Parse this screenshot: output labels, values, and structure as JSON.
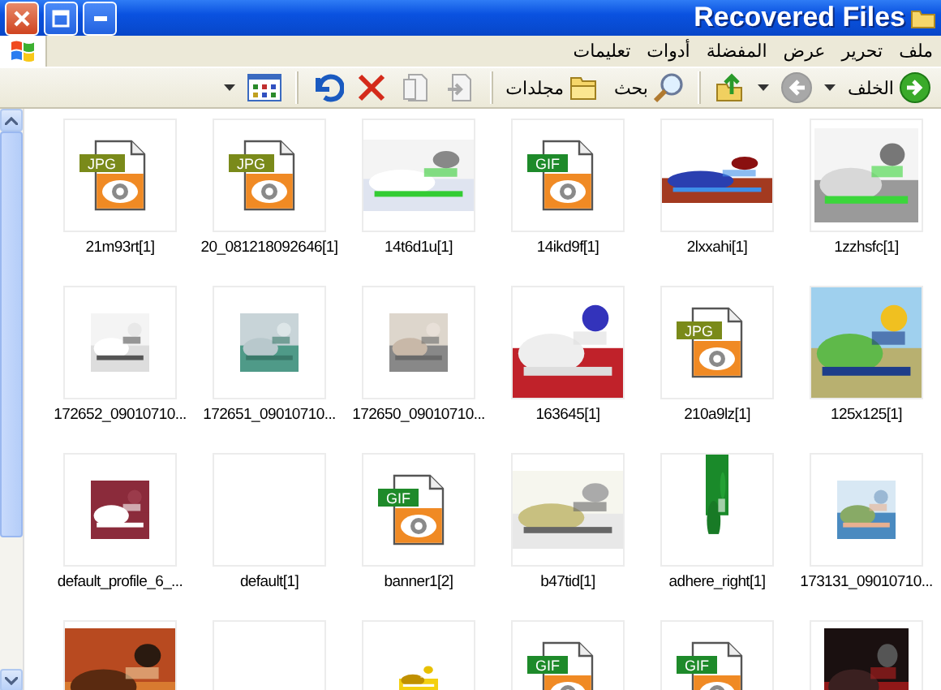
{
  "window": {
    "title": "Recovered Files"
  },
  "menu": [
    "ملف",
    "تحرير",
    "عرض",
    "المفضلة",
    "أدوات",
    "تعليمات"
  ],
  "toolbar": [
    {
      "kind": "back",
      "label": "الخلف",
      "disabled": false
    },
    {
      "kind": "forward",
      "disabled": true
    },
    {
      "kind": "up",
      "disabled": false
    },
    {
      "kind": "separator"
    },
    {
      "kind": "search",
      "label": "بحث",
      "disabled": false
    },
    {
      "kind": "folders",
      "label": "مجلدات",
      "disabled": false
    },
    {
      "kind": "separator"
    },
    {
      "kind": "move",
      "disabled": true
    },
    {
      "kind": "copy",
      "disabled": true
    },
    {
      "kind": "delete",
      "disabled": false
    },
    {
      "kind": "undo",
      "disabled": false
    },
    {
      "kind": "separator"
    },
    {
      "kind": "views",
      "disabled": false
    }
  ],
  "files": [
    {
      "label": "21m93rt[1]",
      "kind": "file-icon",
      "badge": "JPG",
      "color": "#7a8a1a"
    },
    {
      "label": "20_081218092646[1]",
      "kind": "file-icon",
      "badge": "JPG",
      "color": "#7a8a1a"
    },
    {
      "label": "14t6d1u[1]",
      "kind": "picture"
    },
    {
      "label": "14ikd9f[1]",
      "kind": "file-icon",
      "badge": "GIF",
      "color": "#1e8a2a"
    },
    {
      "label": "2lxxahi[1]",
      "kind": "picture"
    },
    {
      "label": "1zzhsfc[1]",
      "kind": "picture"
    },
    {
      "label": "172652_09010710...",
      "kind": "picture"
    },
    {
      "label": "172651_09010710...",
      "kind": "picture"
    },
    {
      "label": "172650_09010710...",
      "kind": "picture"
    },
    {
      "label": "163645[1]",
      "kind": "picture"
    },
    {
      "label": "210a9lz[1]",
      "kind": "file-icon",
      "badge": "JPG",
      "color": "#7a8a1a"
    },
    {
      "label": "125x125[1]",
      "kind": "picture"
    },
    {
      "label": "default_profile_6_...",
      "kind": "picture"
    },
    {
      "label": "default[1]",
      "kind": "empty"
    },
    {
      "label": "banner1[2]",
      "kind": "file-icon",
      "badge": "GIF",
      "color": "#1e8a2a"
    },
    {
      "label": "b47tid[1]",
      "kind": "picture"
    },
    {
      "label": "adhere_right[1]",
      "kind": "picture"
    },
    {
      "label": "173131_09010710...",
      "kind": "picture"
    },
    {
      "kind": "picture"
    },
    {
      "kind": "empty"
    },
    {
      "kind": "picture"
    },
    {
      "kind": "file-icon",
      "badge": "GIF",
      "color": "#1e8a2a"
    },
    {
      "kind": "file-icon",
      "badge": "GIF",
      "color": "#1e8a2a"
    },
    {
      "kind": "picture"
    }
  ]
}
